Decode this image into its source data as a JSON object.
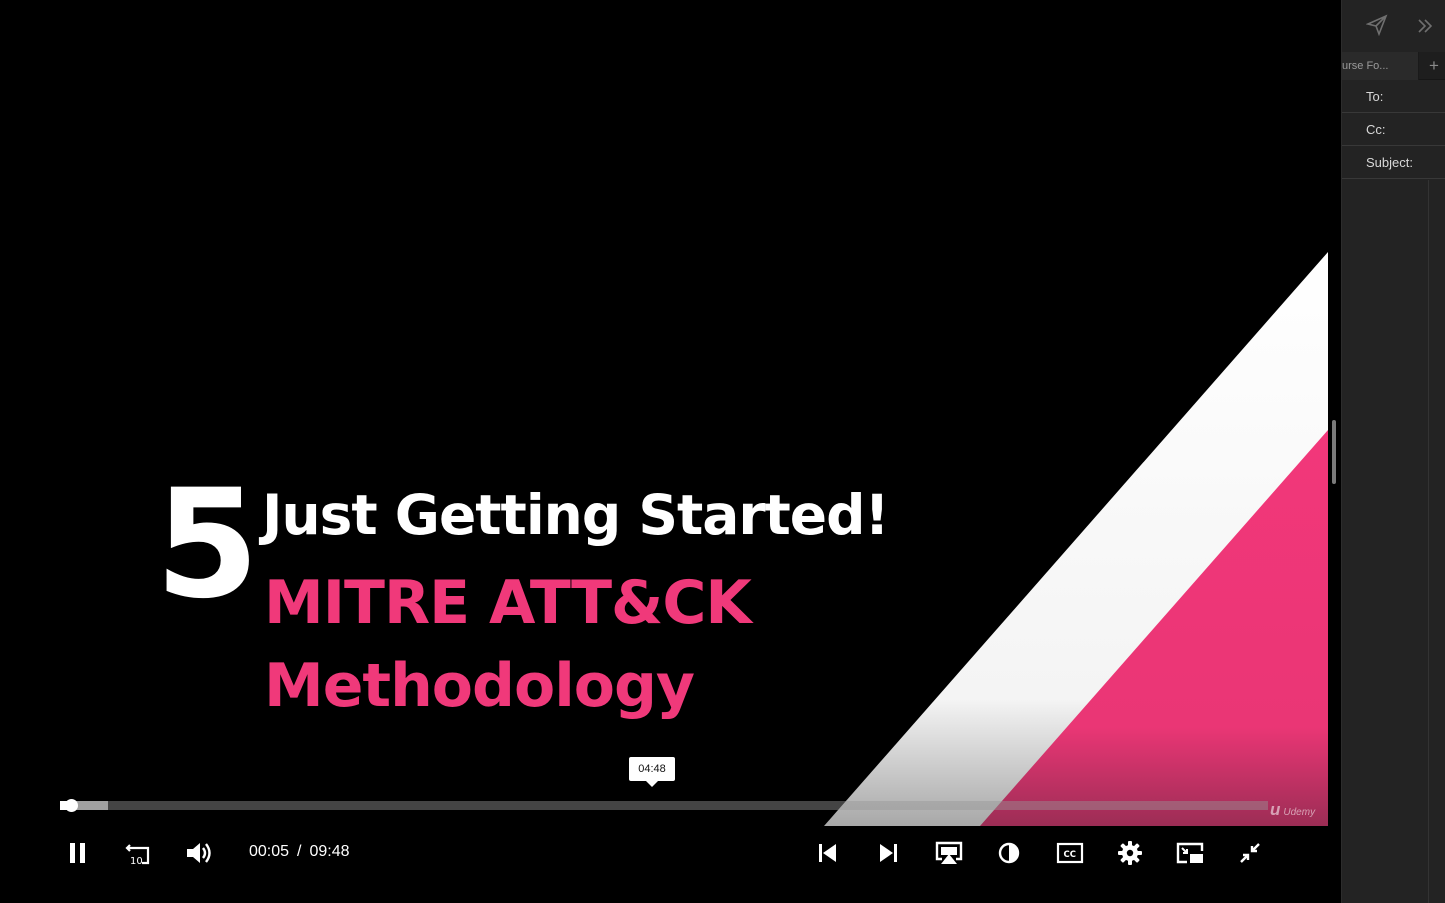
{
  "slide": {
    "number": "5",
    "title": "Just Getting Started!",
    "subtitle_line1": "MITRE ATT&CK",
    "subtitle_line2": "Methodology",
    "brand": "Udemy",
    "brand_glyph": "u"
  },
  "player": {
    "current_time": "00:05",
    "separator": "/",
    "duration": "09:48",
    "played_fraction": 0.009,
    "buffered_fraction": 0.04,
    "hover_time": "04:48",
    "rewind_seconds": "10"
  },
  "colors": {
    "accent_pink": "#f0397a",
    "white_stripe": "#ffffff",
    "side_panel_bg": "#232323"
  },
  "icons": {
    "play_pause": "pause-icon",
    "rewind": "rewind-10-icon",
    "volume": "volume-icon",
    "previous": "skip-previous-icon",
    "next": "skip-next-icon",
    "cast": "airplay-icon",
    "theatre": "contrast-icon",
    "captions": "closed-captions-icon",
    "settings": "gear-icon",
    "pip": "picture-in-picture-icon",
    "fullscreen": "exit-fullscreen-icon"
  },
  "compose": {
    "tab_title": "urse Fo...",
    "add_tab": "+",
    "to_label": "To:",
    "cc_label": "Cc:",
    "subject_label": "Subject:"
  }
}
